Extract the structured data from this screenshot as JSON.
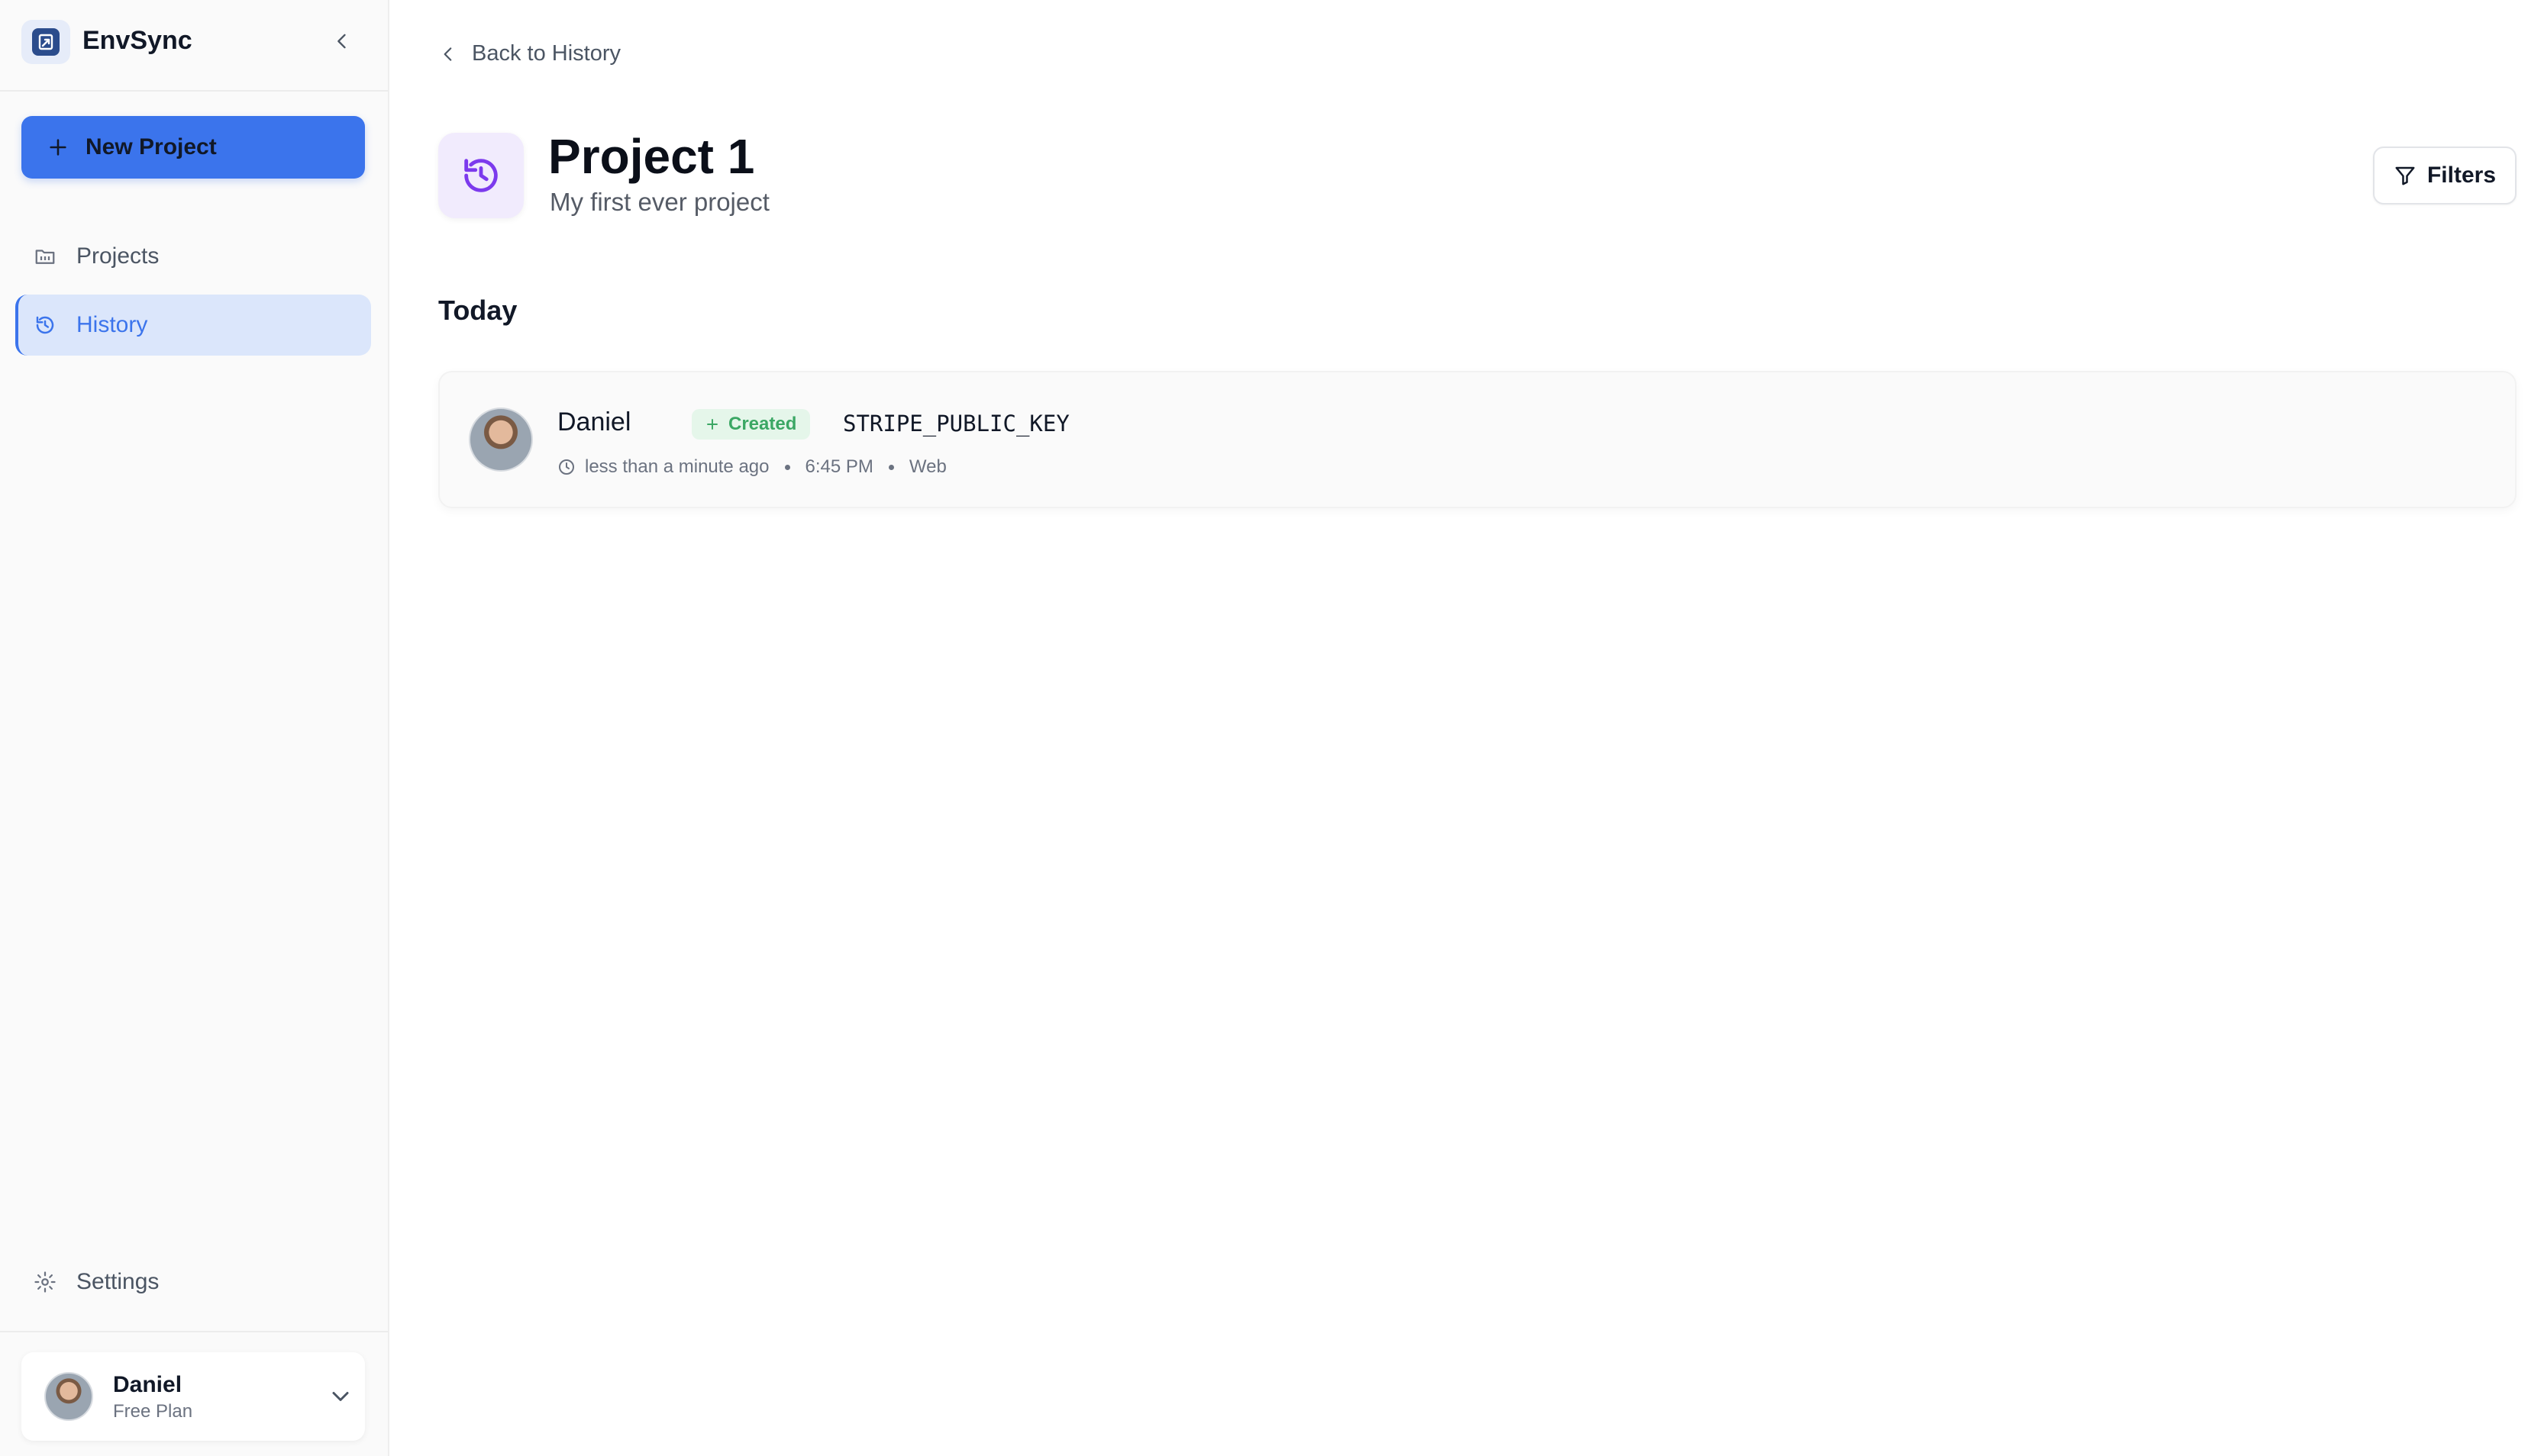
{
  "app": {
    "name": "EnvSync",
    "colors": {
      "accent": "#3b74ec",
      "created_badge_bg": "#e5f6ea",
      "created_badge_fg": "#3ba764",
      "header_icon_bg": "#f1ebfd",
      "header_icon_fg": "#7c3aed"
    }
  },
  "sidebar": {
    "new_project_label": "New Project",
    "items": [
      {
        "label": "Projects",
        "icon": "folder-icon",
        "active": false
      },
      {
        "label": "History",
        "icon": "history-icon",
        "active": true
      }
    ],
    "settings_label": "Settings",
    "user": {
      "name": "Daniel",
      "plan": "Free Plan"
    }
  },
  "main": {
    "back_label": "Back to History",
    "title": "Project 1",
    "subtitle": "My first ever project",
    "filters_label": "Filters",
    "groups": [
      {
        "heading": "Today",
        "entries": [
          {
            "actor": "Daniel",
            "action": "Created",
            "key": "STRIPE_PUBLIC_KEY",
            "relative_time": "less than a minute ago",
            "time": "6:45 PM",
            "source": "Web"
          }
        ]
      }
    ]
  }
}
